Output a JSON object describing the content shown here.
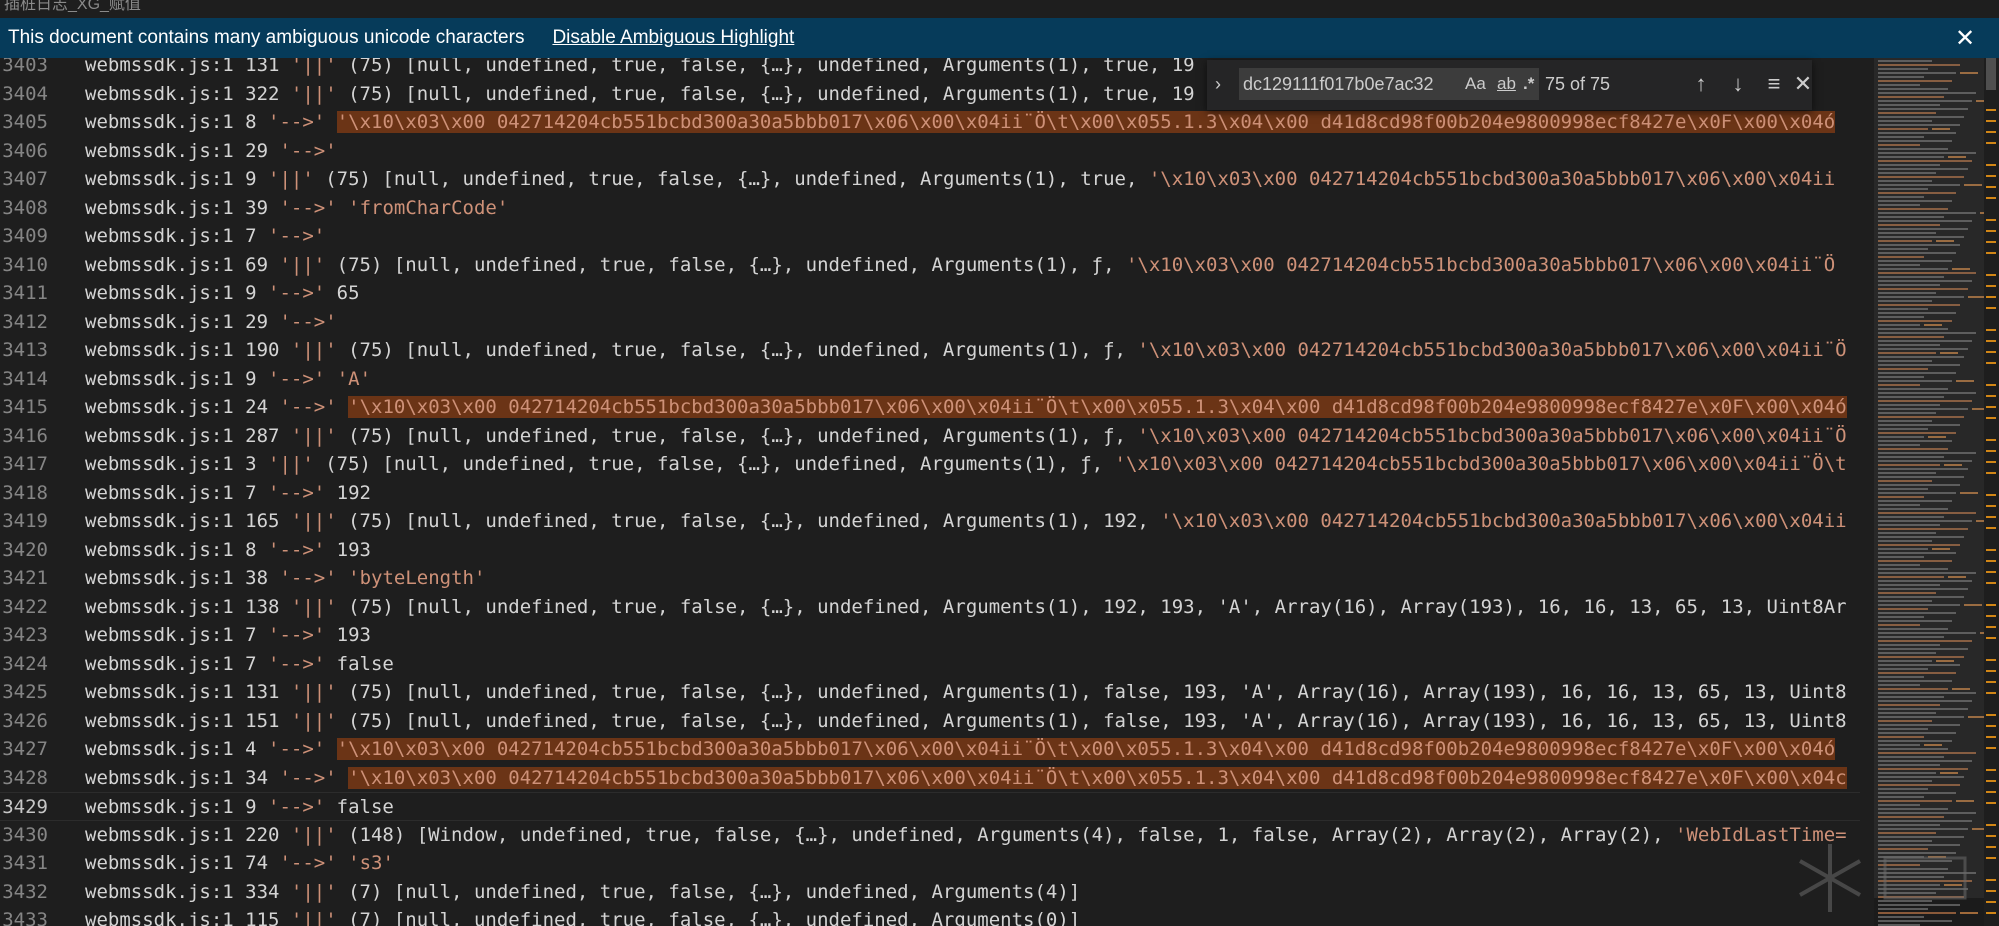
{
  "window": {
    "title": "插桩日志_XG_赋值"
  },
  "banner": {
    "message": "This document contains many ambiguous unicode characters",
    "action": "Disable Ambiguous Highlight"
  },
  "find": {
    "query": "dc129111f017b0e7ac32",
    "match_case": "Aa",
    "whole_word": "ab",
    "regex": ".*",
    "count": "75 of 75"
  },
  "theme": {
    "background": "#1e1e1e",
    "string_color": "#ce9178",
    "highlight": "#6b3416",
    "banner": "#063b5a"
  },
  "editor": {
    "current_line": 26,
    "lines": [
      {
        "n": "3403",
        "pre": "webmssdk.js:1 131 ",
        "str": "'||'",
        "post": " (75) [null, undefined, true, false, {…}, undefined, Arguments(1), true, 19",
        "hlstr": "",
        "tail": ""
      },
      {
        "n": "3404",
        "pre": "webmssdk.js:1 322 ",
        "str": "'||'",
        "post": " (75) [null, undefined, true, false, {…}, undefined, Arguments(1), true, 19",
        "hlstr": "",
        "tail": ""
      },
      {
        "n": "3405",
        "pre": "webmssdk.js:1 8 ",
        "str": "'-->'",
        "post": " ",
        "hlstr": "'\\x10\\x03\\x00 042714204cb551bcbd300a30a5bbb017\\x06\\x00\\x04ii¨Ö\\t\\x00\\x055.1.3\\x04\\x00 d41d8cd98f00b204e9800998ecf8427e\\x0F\\x00\\x04ó",
        "tail": ""
      },
      {
        "n": "3406",
        "pre": "webmssdk.js:1 29 ",
        "str": "'-->'",
        "post": "",
        "hlstr": "",
        "tail": ""
      },
      {
        "n": "3407",
        "pre": "webmssdk.js:1 9 ",
        "str": "'||'",
        "post": " (75) [null, undefined, true, false, {…}, undefined, Arguments(1), true, ",
        "hlstr": "",
        "tail": "'\\x10\\x03\\x00 042714204cb551bcbd300a30a5bbb017\\x06\\x00\\x04ii"
      },
      {
        "n": "3408",
        "pre": "webmssdk.js:1 39 ",
        "str": "'-->'",
        "post": " ",
        "hlstr": "",
        "tail": "'fromCharCode'"
      },
      {
        "n": "3409",
        "pre": "webmssdk.js:1 7 ",
        "str": "'-->'",
        "post": "",
        "hlstr": "",
        "tail": ""
      },
      {
        "n": "3410",
        "pre": "webmssdk.js:1 69 ",
        "str": "'||'",
        "post": " (75) [null, undefined, true, false, {…}, undefined, Arguments(1), ƒ, ",
        "hlstr": "",
        "tail": "'\\x10\\x03\\x00 042714204cb551bcbd300a30a5bbb017\\x06\\x00\\x04ii¨Ö"
      },
      {
        "n": "3411",
        "pre": "webmssdk.js:1 9 ",
        "str": "'-->'",
        "post": " 65",
        "hlstr": "",
        "tail": ""
      },
      {
        "n": "3412",
        "pre": "webmssdk.js:1 29 ",
        "str": "'-->'",
        "post": "",
        "hlstr": "",
        "tail": ""
      },
      {
        "n": "3413",
        "pre": "webmssdk.js:1 190 ",
        "str": "'||'",
        "post": " (75) [null, undefined, true, false, {…}, undefined, Arguments(1), ƒ, ",
        "hlstr": "",
        "tail": "'\\x10\\x03\\x00 042714204cb551bcbd300a30a5bbb017\\x06\\x00\\x04ii¨Ö"
      },
      {
        "n": "3414",
        "pre": "webmssdk.js:1 9 ",
        "str": "'-->'",
        "post": " ",
        "hlstr": "",
        "tail": "'A'"
      },
      {
        "n": "3415",
        "pre": "webmssdk.js:1 24 ",
        "str": "'-->'",
        "post": " ",
        "hlstr": "'\\x10\\x03\\x00 042714204cb551bcbd300a30a5bbb017\\x06\\x00\\x04ii¨Ö\\t\\x00\\x055.1.3\\x04\\x00 d41d8cd98f00b204e9800998ecf8427e\\x0F\\x00\\x04ó",
        "tail": ""
      },
      {
        "n": "3416",
        "pre": "webmssdk.js:1 287 ",
        "str": "'||'",
        "post": " (75) [null, undefined, true, false, {…}, undefined, Arguments(1), ƒ, ",
        "hlstr": "",
        "tail": "'\\x10\\x03\\x00 042714204cb551bcbd300a30a5bbb017\\x06\\x00\\x04ii¨Ö"
      },
      {
        "n": "3417",
        "pre": "webmssdk.js:1 3 ",
        "str": "'||'",
        "post": " (75) [null, undefined, true, false, {…}, undefined, Arguments(1), ƒ, ",
        "hlstr": "",
        "tail": "'\\x10\\x03\\x00 042714204cb551bcbd300a30a5bbb017\\x06\\x00\\x04ii¨Ö\\t"
      },
      {
        "n": "3418",
        "pre": "webmssdk.js:1 7 ",
        "str": "'-->'",
        "post": " 192",
        "hlstr": "",
        "tail": ""
      },
      {
        "n": "3419",
        "pre": "webmssdk.js:1 165 ",
        "str": "'||'",
        "post": " (75) [null, undefined, true, false, {…}, undefined, Arguments(1), 192, ",
        "hlstr": "",
        "tail": "'\\x10\\x03\\x00 042714204cb551bcbd300a30a5bbb017\\x06\\x00\\x04ii"
      },
      {
        "n": "3420",
        "pre": "webmssdk.js:1 8 ",
        "str": "'-->'",
        "post": " 193",
        "hlstr": "",
        "tail": ""
      },
      {
        "n": "3421",
        "pre": "webmssdk.js:1 38 ",
        "str": "'-->'",
        "post": " ",
        "hlstr": "",
        "tail": "'byteLength'"
      },
      {
        "n": "3422",
        "pre": "webmssdk.js:1 138 ",
        "str": "'||'",
        "post": " (75) [null, undefined, true, false, {…}, undefined, Arguments(1), 192, 193, 'A', Array(16), Array(193), 16, 16, 13, 65, 13, Uint8Ar",
        "hlstr": "",
        "tail": ""
      },
      {
        "n": "3423",
        "pre": "webmssdk.js:1 7 ",
        "str": "'-->'",
        "post": " 193",
        "hlstr": "",
        "tail": ""
      },
      {
        "n": "3424",
        "pre": "webmssdk.js:1 7 ",
        "str": "'-->'",
        "post": " false",
        "hlstr": "",
        "tail": ""
      },
      {
        "n": "3425",
        "pre": "webmssdk.js:1 131 ",
        "str": "'||'",
        "post": " (75) [null, undefined, true, false, {…}, undefined, Arguments(1), false, 193, 'A', Array(16), Array(193), 16, 16, 13, 65, 13, Uint8",
        "hlstr": "",
        "tail": ""
      },
      {
        "n": "3426",
        "pre": "webmssdk.js:1 151 ",
        "str": "'||'",
        "post": " (75) [null, undefined, true, false, {…}, undefined, Arguments(1), false, 193, 'A', Array(16), Array(193), 16, 16, 13, 65, 13, Uint8",
        "hlstr": "",
        "tail": ""
      },
      {
        "n": "3427",
        "pre": "webmssdk.js:1 4 ",
        "str": "'-->'",
        "post": " ",
        "hlstr": "'\\x10\\x03\\x00 042714204cb551bcbd300a30a5bbb017\\x06\\x00\\x04ii¨Ö\\t\\x00\\x055.1.3\\x04\\x00 d41d8cd98f00b204e9800998ecf8427e\\x0F\\x00\\x04ó",
        "tail": ""
      },
      {
        "n": "3428",
        "pre": "webmssdk.js:1 34 ",
        "str": "'-->'",
        "post": " ",
        "hlstr": "'\\x10\\x03\\x00 042714204cb551bcbd300a30a5bbb017\\x06\\x00\\x04ii¨Ö\\t\\x00\\x055.1.3\\x04\\x00 d41d8cd98f00b204e9800998ecf8427e\\x0F\\x00\\x04c",
        "tail": ""
      },
      {
        "n": "3429",
        "pre": "webmssdk.js:1 9 ",
        "str": "'-->'",
        "post": " false",
        "hlstr": "",
        "tail": ""
      },
      {
        "n": "3430",
        "pre": "webmssdk.js:1 220 ",
        "str": "'||'",
        "post": " (148) [Window, undefined, true, false, {…}, undefined, Arguments(4), false, 1, false, Array(2), Array(2), Array(2), ",
        "hlstr": "",
        "tail": "'WebIdLastTime="
      },
      {
        "n": "3431",
        "pre": "webmssdk.js:1 74 ",
        "str": "'-->'",
        "post": " ",
        "hlstr": "",
        "tail": "'s3'"
      },
      {
        "n": "3432",
        "pre": "webmssdk.js:1 334 ",
        "str": "'||'",
        "post": " (7) [null, undefined, true, false, {…}, undefined, Arguments(4)]",
        "hlstr": "",
        "tail": ""
      },
      {
        "n": "3433",
        "pre": "webmssdk.js:1 115 ",
        "str": "'||'",
        "post": " (7) [null, undefined, true, false, {…}, undefined, Arguments(0)]",
        "hlstr": "",
        "tail": ""
      }
    ]
  }
}
